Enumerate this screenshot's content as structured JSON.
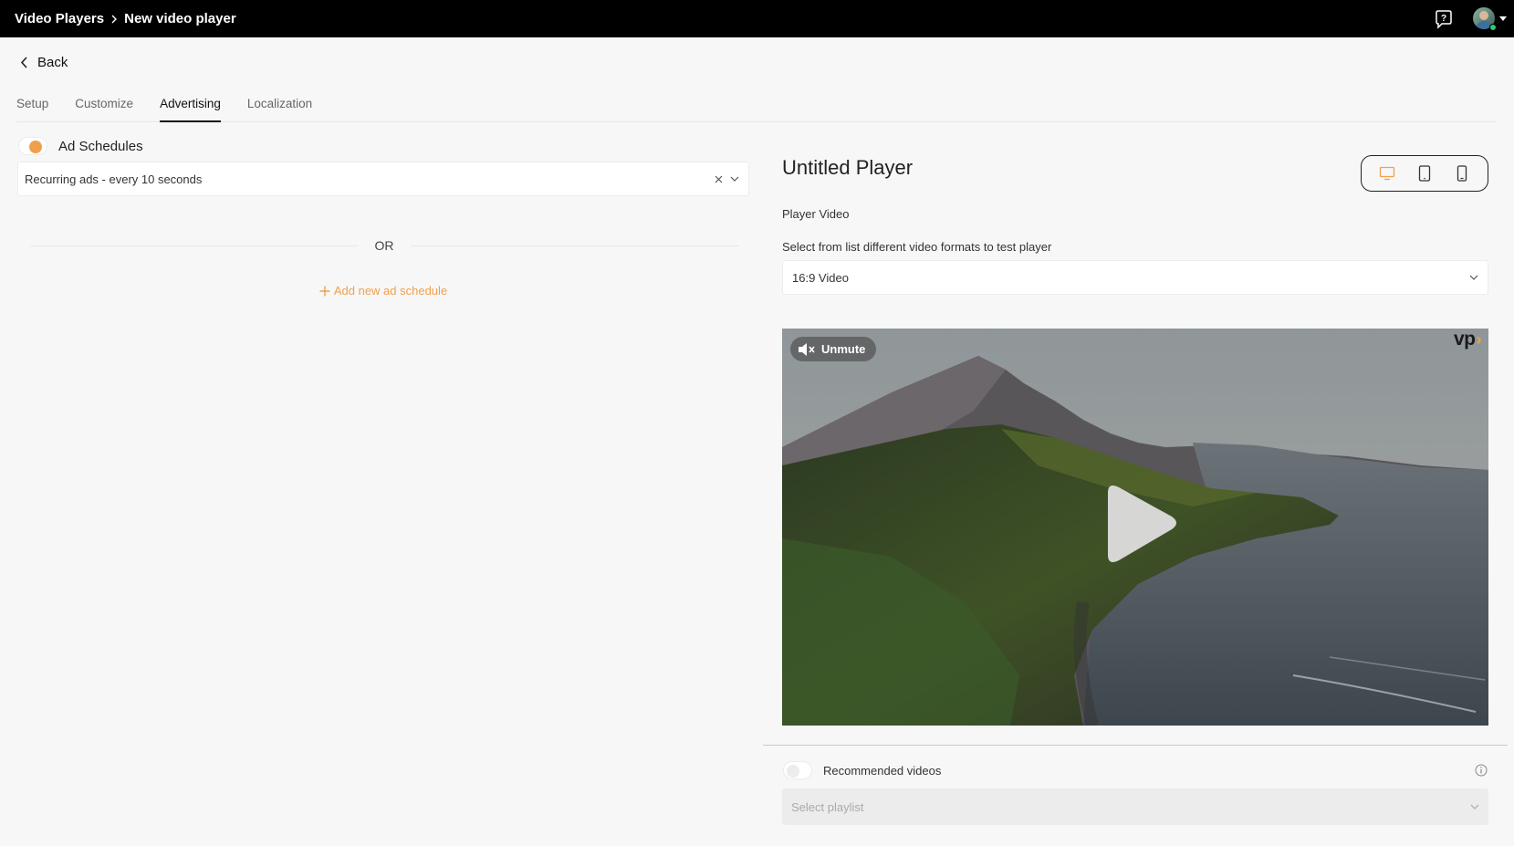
{
  "header": {
    "breadcrumb": [
      "Video Players",
      "New video player"
    ]
  },
  "back_label": "Back",
  "tabs": [
    {
      "label": "Setup",
      "active": false
    },
    {
      "label": "Customize",
      "active": false
    },
    {
      "label": "Advertising",
      "active": true
    },
    {
      "label": "Localization",
      "active": false
    }
  ],
  "ad_schedules": {
    "label": "Ad Schedules",
    "enabled": true,
    "selected": "Recurring ads - every 10 seconds",
    "or_text": "OR",
    "add_label": "Add new ad schedule"
  },
  "preview": {
    "title": "Untitled Player",
    "player_video_label": "Player Video",
    "format_hint": "Select from list different video formats to test player",
    "format_selected": "16:9 Video",
    "devices": [
      "desktop-icon",
      "tablet-icon",
      "mobile-icon"
    ],
    "active_device": "desktop-icon",
    "unmute_label": "Unmute",
    "logo_text": "vp"
  },
  "recommended": {
    "label": "Recommended videos",
    "enabled": false,
    "playlist_placeholder": "Select playlist"
  },
  "colors": {
    "accent": "#f0a04b",
    "topbar": "#000000",
    "background": "#f7f7f7"
  }
}
